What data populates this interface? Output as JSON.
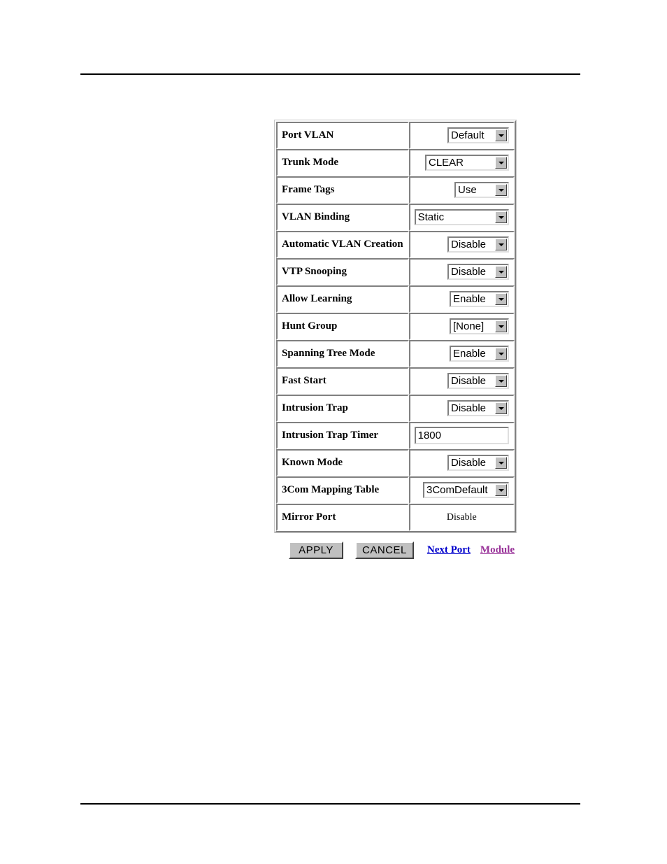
{
  "page": {
    "top_rule": true,
    "bottom_rule": true
  },
  "form": {
    "rows": [
      {
        "label": "Port VLAN",
        "control": "select",
        "value": "Default",
        "width_class": "w-default",
        "align": "right"
      },
      {
        "label": "Trunk Mode",
        "control": "select",
        "value": "CLEAR",
        "width_class": "w-clear",
        "align": "right"
      },
      {
        "label": "Frame Tags",
        "control": "select",
        "value": "Use",
        "width_class": "w-use",
        "align": "right"
      },
      {
        "label": "VLAN Binding",
        "control": "select",
        "value": "Static",
        "width_class": "w-static",
        "align": "left"
      },
      {
        "label": "Automatic VLAN Creation",
        "control": "select",
        "value": "Disable",
        "width_class": "w-disable",
        "align": "right"
      },
      {
        "label": "VTP Snooping",
        "control": "select",
        "value": "Disable",
        "width_class": "w-disable",
        "align": "right"
      },
      {
        "label": "Allow Learning",
        "control": "select",
        "value": "Enable",
        "width_class": "w-enable",
        "align": "right"
      },
      {
        "label": "Hunt Group",
        "control": "select",
        "value": "[None]",
        "width_class": "w-none",
        "align": "right"
      },
      {
        "label": "Spanning Tree Mode",
        "control": "select",
        "value": "Enable",
        "width_class": "w-enable",
        "align": "right"
      },
      {
        "label": "Fast Start",
        "control": "select",
        "value": "Disable",
        "width_class": "w-disable",
        "align": "right"
      },
      {
        "label": "Intrusion Trap",
        "control": "select",
        "value": "Disable",
        "width_class": "w-disable",
        "align": "right"
      },
      {
        "label": "Intrusion Trap Timer",
        "control": "text",
        "value": "1800",
        "width_class": "",
        "align": "left"
      },
      {
        "label": "Known Mode",
        "control": "select",
        "value": "Disable",
        "width_class": "w-disable",
        "align": "right"
      },
      {
        "label": "3Com Mapping Table",
        "control": "select",
        "value": "3ComDefault",
        "width_class": "w-3com",
        "align": "right"
      },
      {
        "label": "Mirror Port",
        "control": "static",
        "value": "Disable",
        "width_class": "",
        "align": "center"
      }
    ]
  },
  "actions": {
    "apply_label": "APPLY",
    "cancel_label": "CANCEL",
    "next_port_link": "Next Port",
    "module_link": "Module",
    "link_color_next_port": "#0000cc",
    "link_color_module": "#993399"
  }
}
